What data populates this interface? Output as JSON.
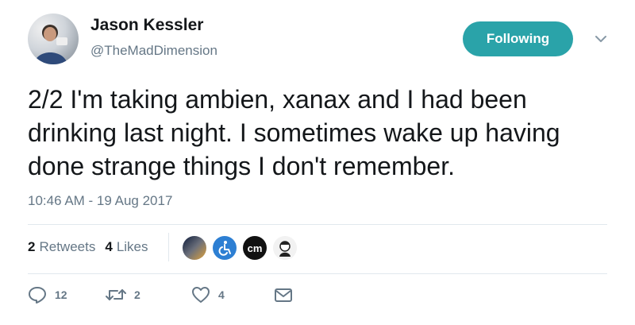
{
  "author": {
    "name": "Jason Kessler",
    "handle": "@TheMadDimension",
    "follow_label": "Following"
  },
  "tweet": {
    "text": "2/2 I'm taking ambien, xanax and I had been drinking last night. I sometimes wake up having done strange things I don't remember.",
    "timestamp": "10:46 AM - 19 Aug 2017"
  },
  "stats": {
    "retweets_count": "2",
    "retweets_label": "Retweets",
    "likes_count": "4",
    "likes_label": "Likes",
    "liker_3_initials": "cm"
  },
  "actions": {
    "reply_count": "12",
    "retweet_count": "2",
    "like_count": "4"
  },
  "colors": {
    "accent": "#2aa3a9",
    "secondary_text": "#657786",
    "divider": "#e1e8ed"
  },
  "icons": [
    "chevron-down-icon",
    "reply-icon",
    "retweet-icon",
    "heart-icon",
    "message-icon",
    "wheelchair-icon"
  ]
}
